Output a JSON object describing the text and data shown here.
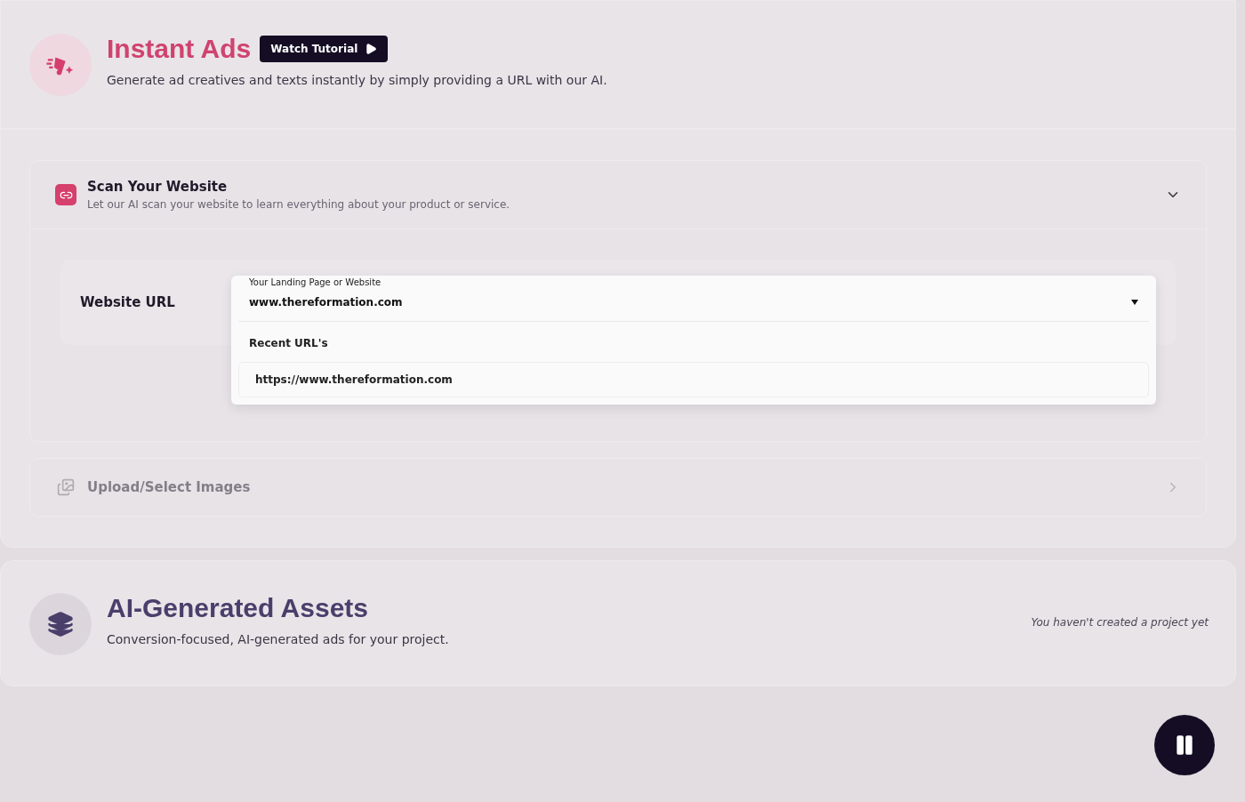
{
  "header": {
    "title": "Instant Ads",
    "tutorial_button": "Watch Tutorial",
    "subtitle": "Generate ad creatives and texts instantly by simply providing a URL with our AI."
  },
  "sections": [
    {
      "title": "Scan Your Website",
      "description": "Let our AI scan your website to learn everything about your product or service.",
      "expanded": true,
      "disabled": false
    },
    {
      "title": "Upload/Select Images",
      "expanded": false,
      "disabled": true
    }
  ],
  "website_url": {
    "label": "Website URL",
    "field": {
      "label": "Your Landing Page or Website",
      "value": "www.thereformation.com"
    },
    "dropdown": {
      "heading": "Recent URL's",
      "items": [
        {
          "text": "https://www.thereformation.com"
        }
      ]
    }
  },
  "assets": {
    "title": "AI-Generated Assets",
    "description": "Conversion-focused, AI-generated ads for your project.",
    "empty_note": "You haven't created a project yet"
  }
}
